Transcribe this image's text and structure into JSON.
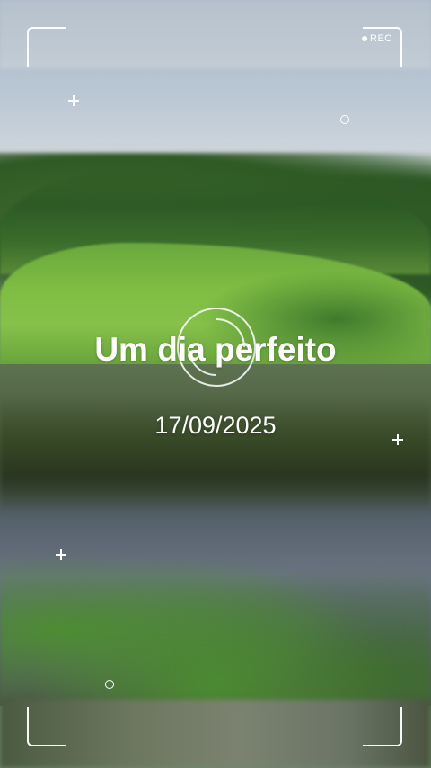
{
  "story": {
    "title": "Um dia perfeito",
    "date": "17/09/2025"
  },
  "viewfinder": {
    "record_label": "REC",
    "overlay_color": "#ffffff"
  },
  "background": {
    "subject": "landscape-photo",
    "sky_color": "#c8d2dc",
    "grass_color": "#7fbd43",
    "water_color": "#5d6572"
  }
}
